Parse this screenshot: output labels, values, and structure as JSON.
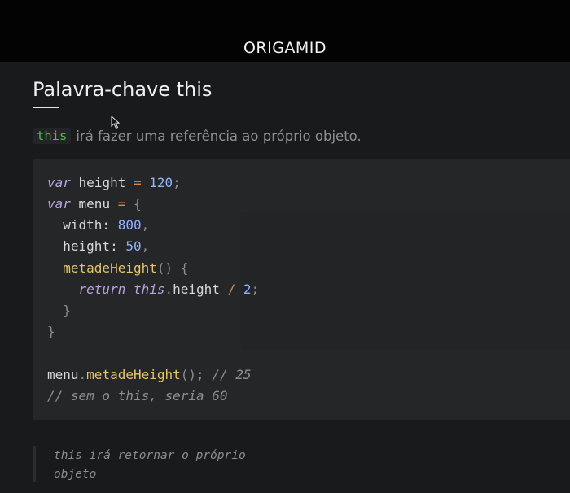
{
  "header": {
    "logo_text": "ORIGAMID"
  },
  "slide": {
    "title": "Palavra-chave this",
    "intro_keyword": "this",
    "intro_text": "irá fazer uma referência ao próprio objeto."
  },
  "code": {
    "lines": [
      "var height = 120;",
      "var menu = {",
      "  width: 800,",
      "  height: 50,",
      "  metadeHeight() {",
      "    return this.height / 2;",
      "  }",
      "}",
      "",
      "menu.metadeHeight(); // 25",
      "// sem o this, seria 60"
    ]
  },
  "note": {
    "line1": "this irá retornar o próprio",
    "line2": "objeto"
  },
  "colors": {
    "keyword": "#b9a3e3",
    "number": "#8fb3ff",
    "function": "#e8c46a",
    "operator": "#d88a4d",
    "this_chip": "#4bc24b"
  }
}
